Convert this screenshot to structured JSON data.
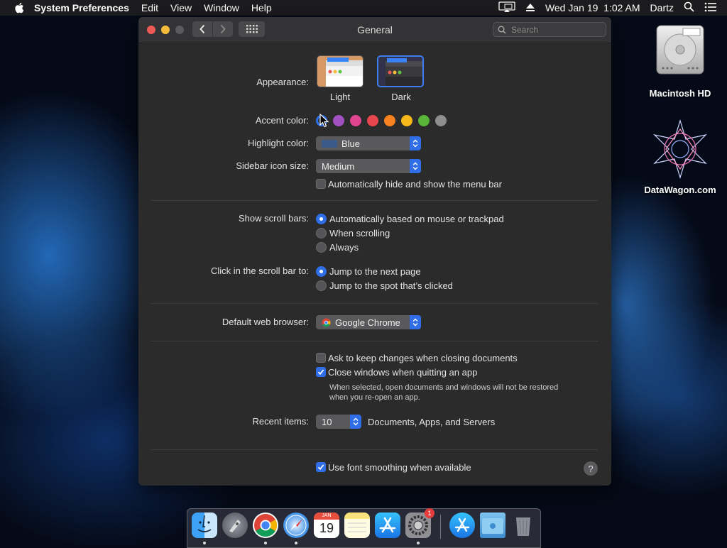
{
  "menubar": {
    "app_name": "System Preferences",
    "menus": [
      "Edit",
      "View",
      "Window",
      "Help"
    ],
    "clock": "Wed Jan 19  1:02 AM",
    "user": "Dartz"
  },
  "desktop": {
    "icons": [
      {
        "label": "Macintosh HD"
      },
      {
        "label": "DataWagon.com"
      }
    ]
  },
  "window": {
    "title": "General",
    "search_placeholder": "Search"
  },
  "appearance": {
    "label": "Appearance:",
    "options": [
      "Light",
      "Dark"
    ],
    "selected": "Dark"
  },
  "accent": {
    "label": "Accent color:",
    "colors": [
      "#2f6ee6",
      "#a050c0",
      "#e0458f",
      "#e8464e",
      "#f5821f",
      "#f7b91a",
      "#5ab639",
      "#8e8e8e"
    ],
    "selected_index": 0
  },
  "highlight": {
    "label": "Highlight color:",
    "value": "Blue",
    "swatch": "#3b5a8a"
  },
  "sidebar_icon_size": {
    "label": "Sidebar icon size:",
    "value": "Medium"
  },
  "menu_bar_autohide": {
    "label": "Automatically hide and show the menu bar",
    "checked": false
  },
  "scroll_bars": {
    "label": "Show scroll bars:",
    "options": [
      "Automatically based on mouse or trackpad",
      "When scrolling",
      "Always"
    ],
    "selected_index": 0
  },
  "scroll_click": {
    "label": "Click in the scroll bar to:",
    "options": [
      "Jump to the next page",
      "Jump to the spot that’s clicked"
    ],
    "selected_index": 0
  },
  "browser": {
    "label": "Default web browser:",
    "value": "Google Chrome"
  },
  "ask_keep_changes": {
    "label": "Ask to keep changes when closing documents",
    "checked": false
  },
  "close_windows": {
    "label": "Close windows when quitting an app",
    "checked": true,
    "note_line1": "When selected, open documents and windows will not be restored",
    "note_line2": "when you re-open an app."
  },
  "recent_items": {
    "label": "Recent items:",
    "value": "10",
    "suffix": "Documents, Apps, and Servers"
  },
  "font_smoothing": {
    "label": "Use font smoothing when available",
    "checked": true
  },
  "help": "?",
  "dock": {
    "calendar_month": "JAN",
    "calendar_day": "19",
    "badge": "1"
  }
}
